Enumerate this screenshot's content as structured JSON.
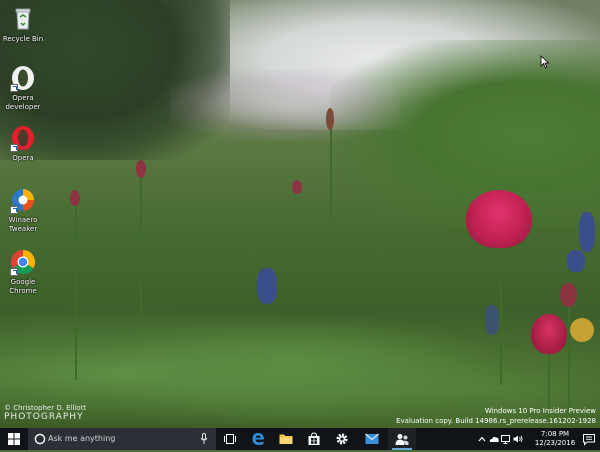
{
  "desktop": {
    "icons": [
      {
        "label": "Recycle Bin",
        "icon": "recycle-bin-icon"
      },
      {
        "label": "Opera developer",
        "icon": "opera-developer-icon"
      },
      {
        "label": "Opera",
        "icon": "opera-icon"
      },
      {
        "label": "Winaero Tweaker",
        "icon": "winaero-tweaker-icon"
      },
      {
        "label": "Google Chrome",
        "icon": "chrome-icon"
      }
    ],
    "photo_credit_line1": "© Christopher D. Elliott",
    "photo_credit_line2": "PHOTOGRAPHY",
    "watermark_line1": "Windows 10 Pro Insider Preview",
    "watermark_line2": "Evaluation copy. Build 14986.rs_prerelease.161202-1928"
  },
  "taskbar": {
    "search_placeholder": "Ask me anything",
    "apps": [
      {
        "name": "task-view",
        "icon": "task-view-icon",
        "active": false
      },
      {
        "name": "edge",
        "icon": "edge-icon",
        "active": false
      },
      {
        "name": "file-explorer",
        "icon": "folder-icon",
        "active": false
      },
      {
        "name": "store",
        "icon": "store-icon",
        "active": false
      },
      {
        "name": "settings",
        "icon": "gear-icon",
        "active": false
      },
      {
        "name": "mail",
        "icon": "mail-icon",
        "active": false
      },
      {
        "name": "people",
        "icon": "people-icon",
        "active": true
      }
    ],
    "clock": {
      "time": "7:08 PM",
      "date": "12/23/2016"
    },
    "tray_icons": [
      "chevron-up-icon",
      "onedrive-icon",
      "network-icon",
      "volume-icon",
      "action-center-icon"
    ]
  },
  "colors": {
    "taskbar_bg": "#101418",
    "search_bg": "#2b2f36",
    "accent": "#6aa5d8"
  }
}
